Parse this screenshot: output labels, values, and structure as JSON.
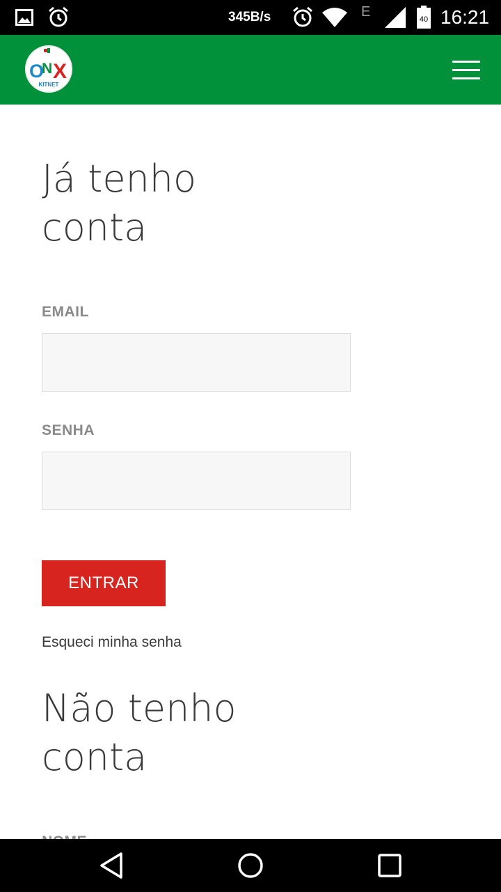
{
  "status_bar": {
    "net_speed": "345B/s",
    "network_type": "E",
    "battery_level": "40",
    "time": "16:21",
    "icons": [
      "image-icon",
      "alarm-icon",
      "alarm-icon",
      "wifi-icon",
      "signal-icon",
      "battery-icon"
    ]
  },
  "header": {
    "logo_text": "ONX",
    "logo_subtext": "KITNET",
    "background_color": "#01913a",
    "menu_icon": "hamburger-menu-icon"
  },
  "login": {
    "title": "Já tenho\nconta",
    "email_label": "EMAIL",
    "email_value": "",
    "password_label": "SENHA",
    "password_value": "",
    "submit_label": "ENTRAR",
    "submit_color": "#d8241f",
    "forgot_link": "Esqueci minha senha"
  },
  "register": {
    "title": "Não tenho\nconta",
    "name_label": "NOME"
  },
  "nav_bar": {
    "icons": [
      "back-icon",
      "home-icon",
      "recent-apps-icon"
    ]
  }
}
